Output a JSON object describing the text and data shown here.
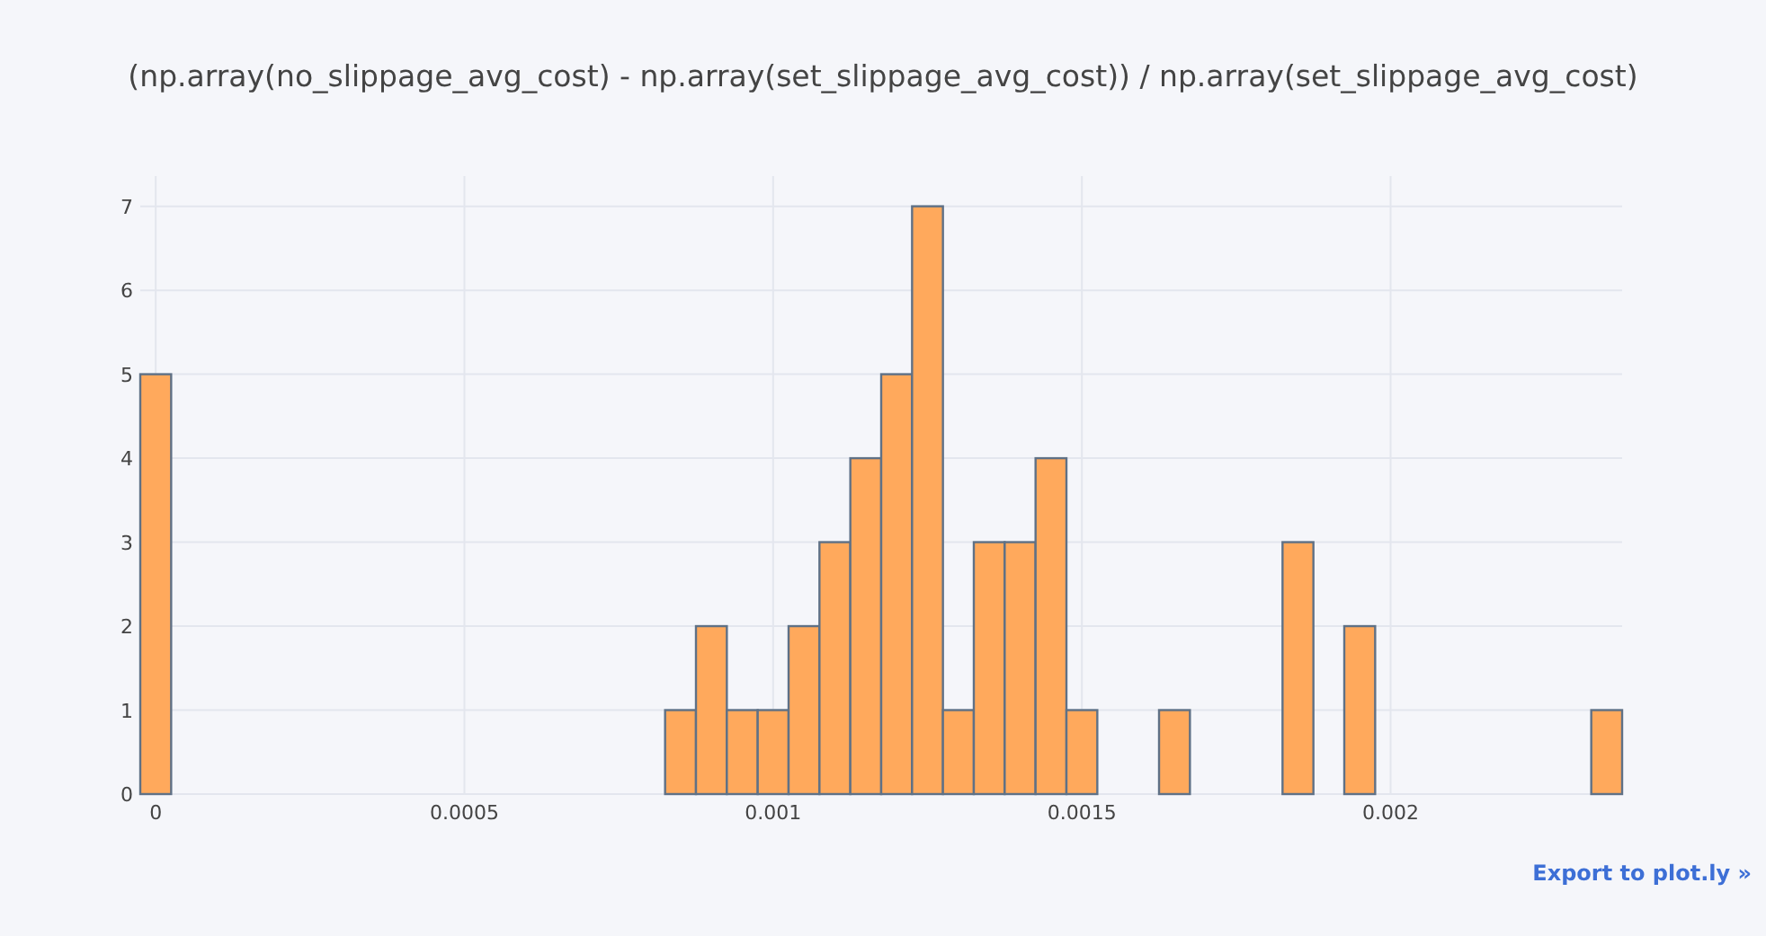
{
  "chart": {
    "chart_data": {
      "type": "bar",
      "title": "(np.array(no_slippage_avg_cost) - np.array(set_slippage_avg_cost)) / np.array(set_slippage_avg_cost)",
      "x": [
        0,
        0.00085,
        0.0009,
        0.00095,
        0.001,
        0.00105,
        0.0011,
        0.00115,
        0.0012,
        0.00125,
        0.0013,
        0.00135,
        0.0014,
        0.00145,
        0.0015,
        0.00165,
        0.00185,
        0.00195,
        0.00235
      ],
      "values": [
        5,
        1,
        2,
        1,
        1,
        2,
        3,
        4,
        5,
        7,
        1,
        3,
        3,
        4,
        1,
        1,
        3,
        2,
        1
      ],
      "xlim": [
        -2.5e-05,
        0.002375
      ],
      "ylim": [
        0,
        7.36
      ],
      "xticks": [
        0,
        0.0005,
        0.001,
        0.0015,
        0.002
      ],
      "yticks": [
        0,
        1,
        2,
        3,
        4,
        5,
        6,
        7
      ],
      "grid": true
    }
  },
  "export_link": "Export to plot.ly »"
}
